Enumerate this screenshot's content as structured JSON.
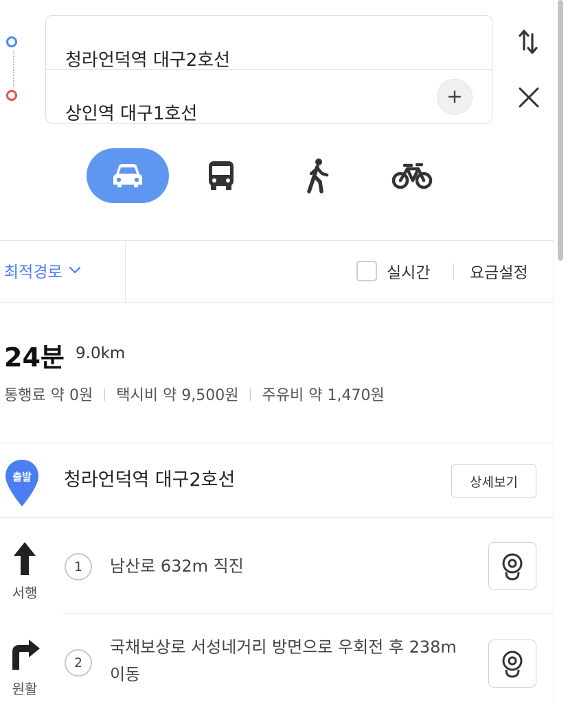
{
  "route": {
    "origin": "청라언덕역 대구2호선",
    "destination": "상인역 대구1호선"
  },
  "icons": {
    "swap": "swap-icon",
    "close": "close-icon",
    "add": "plus-icon"
  },
  "modes": [
    {
      "name": "car",
      "icon": "car-icon",
      "active": true
    },
    {
      "name": "transit",
      "icon": "bus-icon",
      "active": false
    },
    {
      "name": "walk",
      "icon": "walk-icon",
      "active": false
    },
    {
      "name": "bike",
      "icon": "bike-icon",
      "active": false
    }
  ],
  "options": {
    "route_type": "최적경로",
    "realtime_label": "실시간",
    "realtime_checked": false,
    "fare_settings": "요금설정"
  },
  "summary": {
    "time": "24분",
    "distance": "9.0km",
    "toll": "통행료 약 0원",
    "taxi": "택시비 약 9,500원",
    "fuel": "주유비 약 1,470원"
  },
  "start": {
    "badge": "출발",
    "name": "청라언덕역 대구2호선",
    "detail_button": "상세보기"
  },
  "steps": [
    {
      "num": "1",
      "direction_label": "서행",
      "direction_icon": "arrow-up-icon",
      "text": "남산로 632m 직진"
    },
    {
      "num": "2",
      "direction_label": "원활",
      "direction_icon": "turn-right-icon",
      "text": "국채보상로 서성네거리 방면으로 우회전 후 238m 이동"
    }
  ],
  "colors": {
    "accent": "#5f97f0",
    "link": "#4a7ef1",
    "origin_dot": "#4a8af4",
    "dest_dot": "#e8544e"
  }
}
